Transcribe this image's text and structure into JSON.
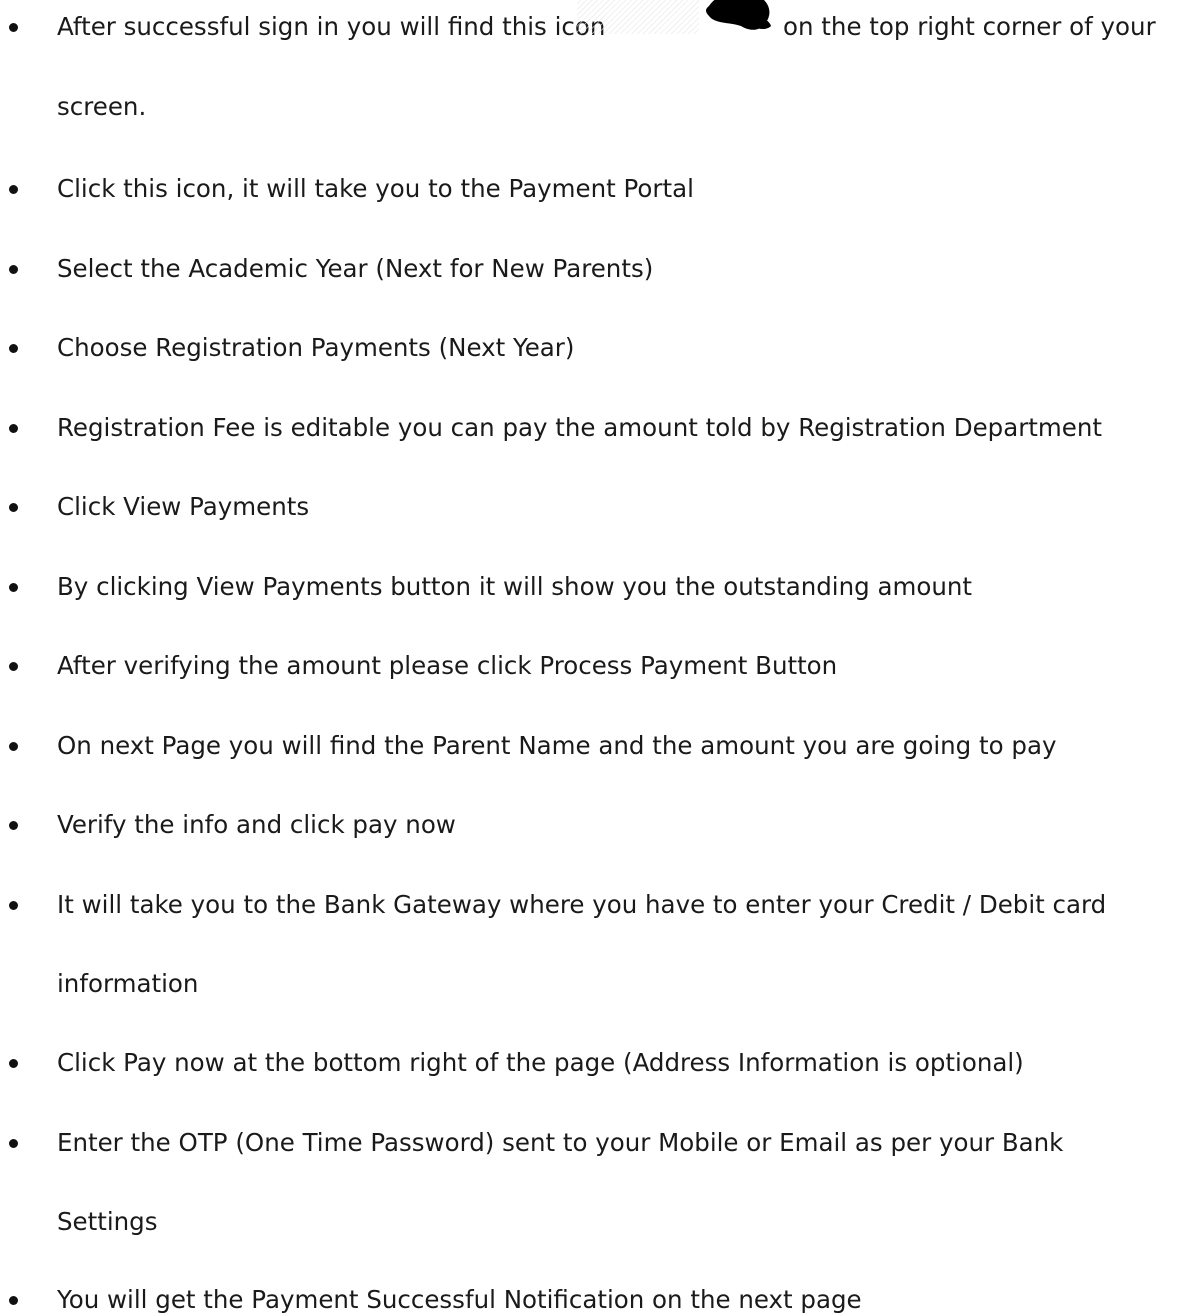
{
  "items": [
    {
      "line1_before_icon": "After successful sign in you will find this icon",
      "icon": "payment-hand-icon",
      "line1_after_icon": "on the top right corner of your",
      "line2": "screen."
    },
    {
      "text": "Click this icon, it will take you to the Payment Portal"
    },
    {
      "text": "Select the Academic Year (Next for New Parents)"
    },
    {
      "text": "Choose Registration Payments (Next Year)"
    },
    {
      "text": "Registration Fee is editable you can pay the amount told by Registration Department"
    },
    {
      "text": "Click View Payments"
    },
    {
      "text": "By clicking View Payments button it will show you the outstanding amount"
    },
    {
      "text": "After verifying the amount please click Process Payment Button"
    },
    {
      "text": "On next Page you will find the Parent Name and the amount you are going to pay"
    },
    {
      "text": "Verify the info and click pay now"
    },
    {
      "line1": "It will take you to the Bank Gateway where you have to enter your Credit / Debit card",
      "line2": "information"
    },
    {
      "text": "Click Pay now at the bottom right of the page (Address Information is optional)"
    },
    {
      "line1": "Enter the OTP (One Time Password) sent to your Mobile or Email as per your Bank",
      "line2": "Settings"
    },
    {
      "text": "You will get the Payment Successful Notification on the next page"
    }
  ]
}
